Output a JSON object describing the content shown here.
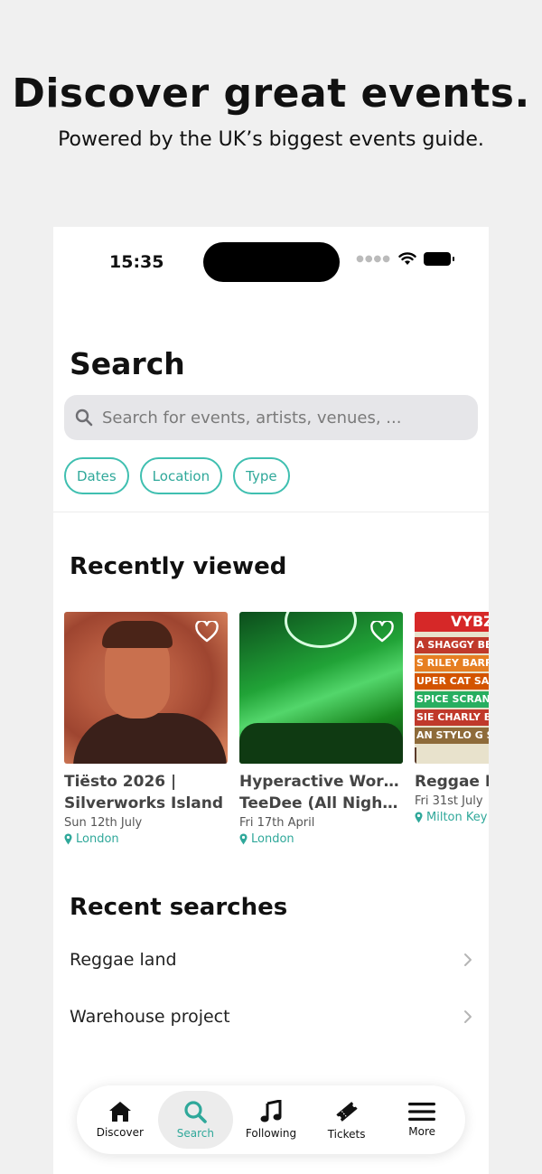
{
  "hero": {
    "title": "Discover great events.",
    "subtitle": "Powered by the UK’s biggest events guide."
  },
  "status_bar": {
    "time": "15:35"
  },
  "search": {
    "title": "Search",
    "placeholder": "Search for events, artists, venues, ...",
    "filters": [
      "Dates",
      "Location",
      "Type"
    ]
  },
  "recently_viewed": {
    "title": "Recently viewed",
    "items": [
      {
        "title": "Tiësto 2026 | Silverworks Island",
        "line1": "Tiësto 2026 |",
        "line2": "Silverworks Island",
        "date": "Sun 12th July",
        "location": "London"
      },
      {
        "title": "Hyperactive World | TeeDee (All Night…",
        "line1": "Hyperactive World |",
        "line2": "TeeDee (All Night…",
        "date": "Fri 17th April",
        "location": "London"
      },
      {
        "title": "Reggae L",
        "line1": "Reggae L",
        "line2": "",
        "date": "Fri 31st July",
        "location": "Milton Key"
      }
    ],
    "poster_text": [
      "VYBZ",
      "A SHAGGY BEENI",
      "S RILEY BARRINGT",
      "UPER CAT SANCHEZ",
      "SPICE SCRANI KEN",
      "SIE CHARLY BLACK",
      "AN STYLO G SAM"
    ]
  },
  "recent_searches": {
    "title": "Recent searches",
    "items": [
      "Reggae land",
      "Warehouse project"
    ]
  },
  "tabbar": {
    "active": "Search",
    "tabs": [
      {
        "label": "Discover",
        "icon": "home-icon"
      },
      {
        "label": "Search",
        "icon": "search-icon"
      },
      {
        "label": "Following",
        "icon": "music-note-icon"
      },
      {
        "label": "Tickets",
        "icon": "ticket-icon"
      },
      {
        "label": "More",
        "icon": "menu-icon"
      }
    ]
  },
  "colors": {
    "accent": "#2fa89a",
    "background": "#f0f0f0",
    "search_field": "#e6e6e9"
  }
}
